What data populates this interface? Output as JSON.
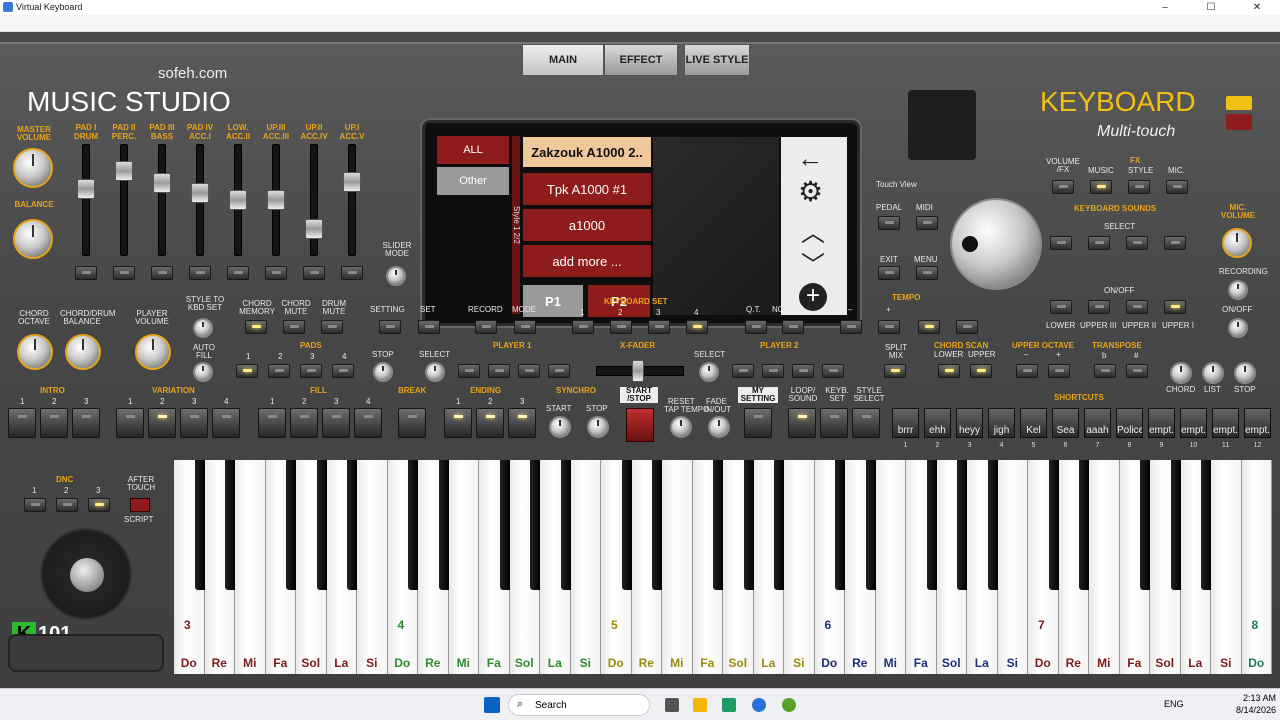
{
  "window": {
    "title": "Virtual Keyboard",
    "controls": [
      "–",
      "☐",
      "✕"
    ]
  },
  "brand": {
    "site": "sofeh.com",
    "studio": "MUSIC STUDIO",
    "keyboard": "KEYBOARD",
    "subtitle": "Multi-touch",
    "logo_num": "101"
  },
  "top_tabs": [
    {
      "label": "MAIN"
    },
    {
      "label": "EFFECT"
    },
    {
      "label": "LIVE STYLE"
    }
  ],
  "screen": {
    "left_tabs": [
      {
        "label": "ALL"
      },
      {
        "label": "Other"
      }
    ],
    "vertical_label": "Style 1 2/2",
    "items": [
      {
        "label": "Zakzouk A1000 2.."
      },
      {
        "label": "Tpk A1000 #1"
      },
      {
        "label": "a1000"
      },
      {
        "label": "add more ..."
      }
    ],
    "pages": [
      {
        "label": "P1"
      },
      {
        "label": "P2"
      }
    ]
  },
  "mixer": {
    "master": "MASTER VOLUME",
    "balance": "BALANCE",
    "channels": [
      {
        "t": "PAD I",
        "b": "DRUM",
        "level": 0.62
      },
      {
        "t": "PAD II",
        "b": "PERC.",
        "level": 0.82
      },
      {
        "t": "PAD III",
        "b": "BASS",
        "level": 0.68
      },
      {
        "t": "PAD IV",
        "b": "ACC.I",
        "level": 0.58
      },
      {
        "t": "LOW.",
        "b": "ACC.II",
        "level": 0.5
      },
      {
        "t": "UP.III",
        "b": "ACC.III",
        "level": 0.5
      },
      {
        "t": "UP.II",
        "b": "ACC.IV",
        "level": 0.18
      },
      {
        "t": "UP.I",
        "b": "ACC.V",
        "level": 0.7
      }
    ],
    "slider_mode": "SLIDER MODE"
  },
  "row2": {
    "chord_octave": "CHORD OCTAVE",
    "cd_balance": "CHORD/DRUM BALANCE",
    "player_volume": "PLAYER VOLUME",
    "style_to_kbd": "STYLE TO KBD SET",
    "auto_fill": "AUTO FILL",
    "chord_memory": "CHORD MEMORY",
    "chord_mute": "CHORD MUTE",
    "drum_mute": "DRUM MUTE",
    "setting": "SETTING",
    "set": "SET",
    "record": "RECORD",
    "mode": "MODE",
    "keyboard_set": "KEYBOARD SET",
    "pads": "PADS",
    "stop": "STOP",
    "player1": "PLAYER 1",
    "player2": "PLAYER 2",
    "xfader": "X-FADER",
    "select": "SELECT",
    "qt": "Q.T.",
    "normal": "NORMAL",
    "tempo": "TEMPO",
    "split_mix": "SPLIT MIX",
    "chord_scan": "CHORD SCAN",
    "lower": "LOWER",
    "upper": "UPPER",
    "upper_octave": "UPPER OCTAVE",
    "transpose": "TRANSPOSE",
    "minus": "–",
    "plus": "+",
    "flat": "b",
    "sharp": "#"
  },
  "right": {
    "touch_view": "Touch View",
    "pedal": "PEDAL",
    "midi": "MIDI",
    "exit": "EXIT",
    "menu": "MENU",
    "volume_fx": "VOLUME /FX",
    "fx": "FX",
    "music": "MUSIC",
    "style": "STYLE",
    "mic": "MIC.",
    "keyboard_sounds": "KEYBOARD SOUNDS",
    "select": "SELECT",
    "on_off": "ON/OFF",
    "lower": "LOWER",
    "upper3": "UPPER III",
    "upper2": "UPPER II",
    "upper1": "UPPER I",
    "mic_volume": "MIC. VOLUME",
    "recording": "RECORDING",
    "mic_onoff": "ON/OFF"
  },
  "row3": {
    "intro": "INTRO",
    "variation": "VARIATION",
    "fill": "FILL",
    "break": "BREAK",
    "ending": "ENDING",
    "synchro": "SYNCHRO",
    "start": "START",
    "stop": "STOP",
    "start_stop": "START /STOP",
    "reset": "RESET",
    "tap_tempo": "TAP TEMPO",
    "fade": "FADE",
    "in_out": "IN/OUT",
    "my_setting": "MY SETTING",
    "loop_sound": "LOOP/ SOUND",
    "keyb_set": "KEYB. SET",
    "style_select": "STYLE SELECT",
    "shortcuts": "SHORTCUTS",
    "chord": "CHORD",
    "list": "LIST",
    "stop2": "STOP"
  },
  "shortcuts": [
    {
      "label": "brrr",
      "n": "1"
    },
    {
      "label": "ehh",
      "n": "2"
    },
    {
      "label": "heyy",
      "n": "3"
    },
    {
      "label": "jigh",
      "n": "4"
    },
    {
      "label": "Kel",
      "n": "5"
    },
    {
      "label": "Sea",
      "n": "6"
    },
    {
      "label": "aaah",
      "n": "7"
    },
    {
      "label": "Police",
      "n": "8"
    },
    {
      "label": "empt..",
      "n": "9"
    },
    {
      "label": "empt..",
      "n": "10"
    },
    {
      "label": "empt..",
      "n": "11"
    },
    {
      "label": "empt..",
      "n": "12"
    }
  ],
  "dnc": {
    "label": "DNC",
    "after_touch": "AFTER TOUCH",
    "script": "SCRIPT"
  },
  "numbers": {
    "n1": "1",
    "n2": "2",
    "n3": "3",
    "n4": "4"
  },
  "notes": [
    "Do",
    "Re",
    "Mi",
    "Fa",
    "Sol",
    "La",
    "Si"
  ],
  "octaves": [
    "3",
    "4",
    "5",
    "6",
    "7",
    "8"
  ],
  "taskbar": {
    "search": "Search",
    "lang": "ENG",
    "time": "2:13 AM",
    "date": "8/14/2026"
  },
  "colors": {
    "accent": "#e9a318",
    "pad": "#8e1c1c",
    "selected": "#f0c79a"
  }
}
